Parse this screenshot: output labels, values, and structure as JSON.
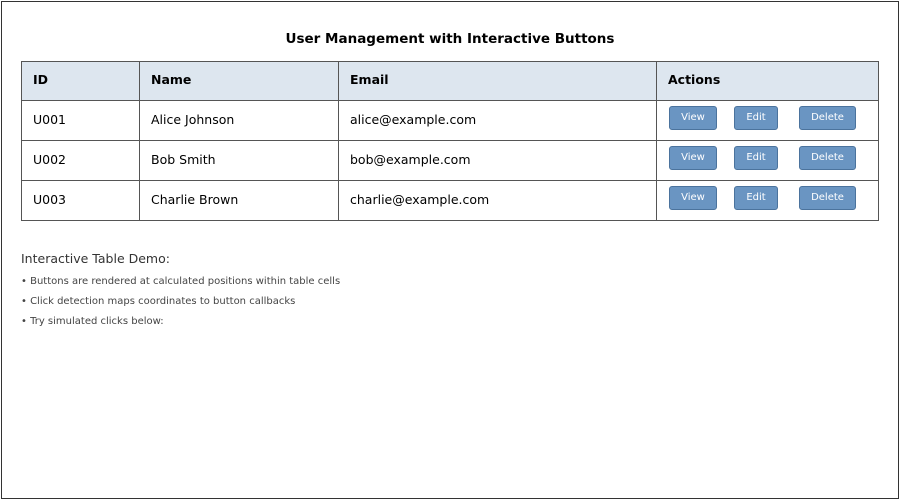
{
  "title": "User Management with Interactive Buttons",
  "table": {
    "headers": [
      "ID",
      "Name",
      "Email",
      "Actions"
    ],
    "rows": [
      {
        "id": "U001",
        "name": "Alice Johnson",
        "email": "alice@example.com"
      },
      {
        "id": "U002",
        "name": "Bob Smith",
        "email": "bob@example.com"
      },
      {
        "id": "U003",
        "name": "Charlie Brown",
        "email": "charlie@example.com"
      }
    ],
    "actions": {
      "view": "View",
      "edit": "Edit",
      "delete": "Delete"
    }
  },
  "notes": {
    "heading": "Interactive Table Demo:",
    "items": [
      "• Buttons are rendered at calculated positions within table cells",
      "• Click detection maps coordinates to button callbacks",
      "• Try simulated clicks below:"
    ]
  },
  "colors": {
    "header_bg": "#dde6ef",
    "button_bg": "#6a95c2",
    "border": "#555555"
  }
}
